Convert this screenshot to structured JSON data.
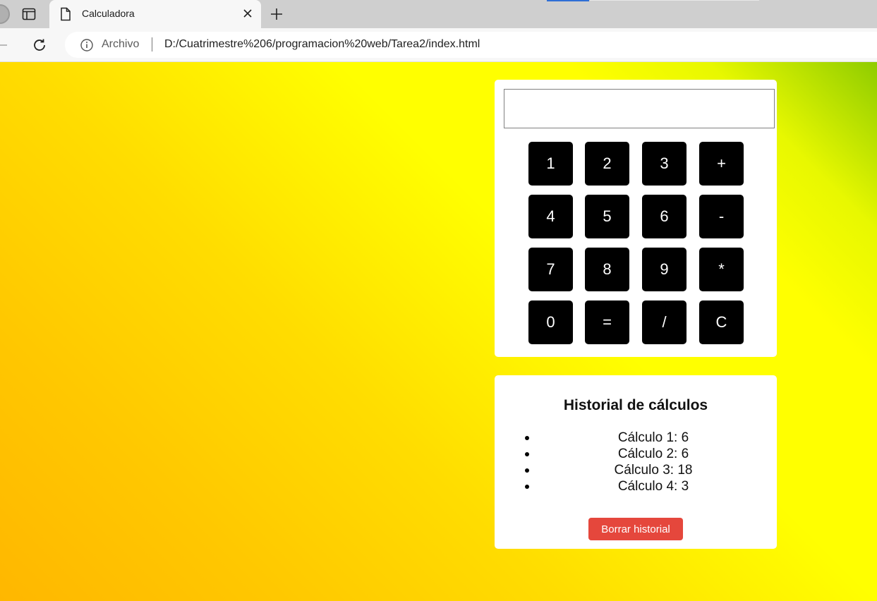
{
  "browser": {
    "tab_title": "Calculadora",
    "address_scheme": "Archivo",
    "address_url": "D:/Cuatrimestre%206/programacion%20web/Tarea2/index.html"
  },
  "calculator": {
    "display_value": "",
    "keys": [
      "1",
      "2",
      "3",
      "+",
      "4",
      "5",
      "6",
      "-",
      "7",
      "8",
      "9",
      "*",
      "0",
      "=",
      "/",
      "C"
    ]
  },
  "history": {
    "title": "Historial de cálculos",
    "items": [
      "Cálculo 1: 6",
      "Cálculo 2: 6",
      "Cálculo 3: 18",
      "Cálculo 4: 3"
    ],
    "clear_label": "Borrar historial"
  },
  "colors": {
    "key_bg": "#000000",
    "clear_button": "#e5473c",
    "page_gradient": [
      "#8fcc00",
      "#ffff00",
      "#ffb700"
    ]
  }
}
